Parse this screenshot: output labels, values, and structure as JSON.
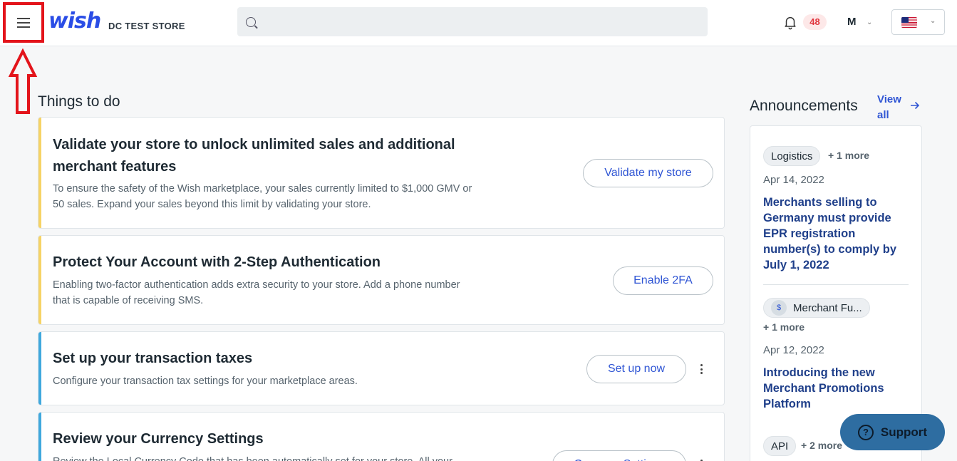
{
  "header": {
    "logo_text": "wish",
    "store_name": "DC TEST STORE",
    "search_placeholder": "",
    "notification_count": "48",
    "user_initial": "M"
  },
  "things_to_do": {
    "title": "Things to do",
    "cards": [
      {
        "title_line1": "Validate your store to unlock unlimited sales and additional",
        "title_line2": "merchant features",
        "desc_line1": "To ensure the safety of the Wish marketplace, your sales currently limited to $1,000 GMV or",
        "desc_line2": "50 sales. Expand your sales beyond this limit by validating your store.",
        "button": "Validate my store",
        "accent": "#f6d365"
      },
      {
        "title_line1": "Protect Your Account with 2-Step Authentication",
        "desc_line1": "Enabling two-factor authentication adds extra security to your store. Add a phone number",
        "desc_line2": "that is capable of receiving SMS.",
        "button": "Enable 2FA",
        "accent": "#f6d365"
      },
      {
        "title_line1": "Set up your transaction taxes",
        "desc_line1": "Configure your transaction tax settings for your marketplace areas.",
        "button": "Set up now",
        "accent": "#3fa8dd"
      },
      {
        "title_line1": "Review your Currency Settings",
        "desc_line1": "Review the Local Currency Code that has been automatically set for your store. All your",
        "button": "Currency Settings",
        "accent": "#3fa8dd"
      }
    ]
  },
  "announcements": {
    "title": "Announcements",
    "view_all": "View all",
    "items": [
      {
        "tag": "Logistics",
        "more": "+ 1 more",
        "date": "Apr 14, 2022",
        "headline": "Merchants selling to Germany must provide EPR registration number(s) to comply by July 1, 2022"
      },
      {
        "tag": "Merchant Fu...",
        "more": "+ 1 more",
        "date": "Apr 12, 2022",
        "headline": "Introducing the new Merchant Promotions Platform"
      },
      {
        "tag": "API",
        "more": "+ 2 more"
      }
    ]
  },
  "support": {
    "label": "Support"
  }
}
